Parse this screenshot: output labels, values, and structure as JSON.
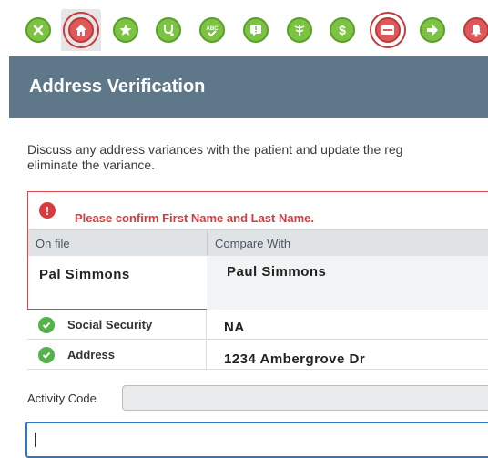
{
  "toolbar": {
    "buttons": [
      {
        "name": "close-icon",
        "color": "green",
        "glyph": "✕"
      },
      {
        "name": "home-icon",
        "color": "red",
        "glyph": "⌂",
        "active": true
      },
      {
        "name": "star-icon",
        "color": "green",
        "glyph": "★"
      },
      {
        "name": "stethoscope-icon",
        "color": "green",
        "glyph": "⚕"
      },
      {
        "name": "spellcheck-icon",
        "color": "green",
        "glyph": "ABC"
      },
      {
        "name": "message-icon",
        "color": "green",
        "glyph": "!"
      },
      {
        "name": "caduceus-icon",
        "color": "green",
        "glyph": "⚕"
      },
      {
        "name": "dollar-icon",
        "color": "green",
        "glyph": "$"
      },
      {
        "name": "card-icon",
        "color": "red",
        "glyph": "▭",
        "active": true
      },
      {
        "name": "arrow-right-icon",
        "color": "green",
        "glyph": "➜"
      },
      {
        "name": "bell-icon",
        "color": "red",
        "glyph": "🔔"
      }
    ]
  },
  "header": {
    "title": "Address Verification"
  },
  "description": {
    "line1": "Discuss any address variances with the patient and update the reg",
    "line2": "eliminate the variance."
  },
  "alert": {
    "message": "Please confirm First Name and Last Name.",
    "col_onfile": "On file",
    "col_compare": "Compare With",
    "onfile_value": "Pal Simmons",
    "compare_value": "Paul Simmons"
  },
  "rows": [
    {
      "label": "Social Security",
      "value": "NA"
    },
    {
      "label": "Address",
      "value": "1234 Ambergrove Dr"
    }
  ],
  "activity": {
    "label": "Activity Code",
    "value": ""
  },
  "colors": {
    "green": "#7cc243",
    "red": "#e0595a",
    "header": "#5e788a",
    "alert": "#d83a3d"
  }
}
